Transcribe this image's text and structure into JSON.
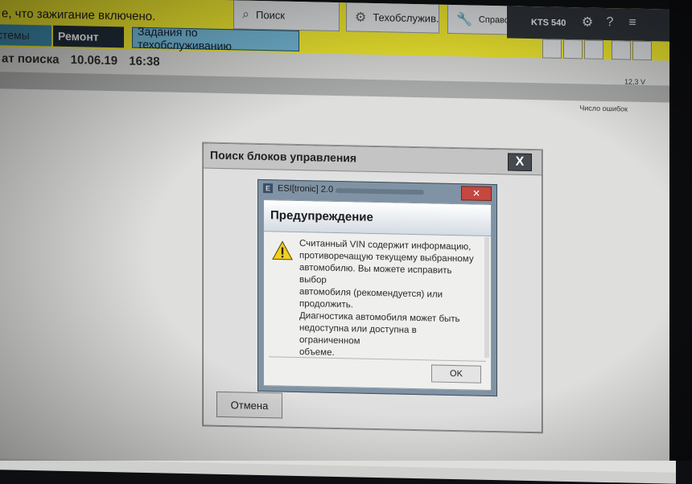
{
  "header": {
    "message": "е, что зажигание включено.",
    "search_button": "Поиск",
    "service_button": "Техобслужив.",
    "reference_button": "Справочники",
    "device": "KTS 540",
    "voltage": "12,3 V"
  },
  "tabs": {
    "systems": "стемы",
    "repair": "Ремонт",
    "service_tasks": "Задания по техобслуживанию"
  },
  "search_info": {
    "label": "ат поиска",
    "date": "10.06.19",
    "time": "16:38"
  },
  "table": {
    "column_header": "Число ошибок"
  },
  "outer_dialog": {
    "title": "Поиск блоков управления",
    "close_label": "X",
    "cancel_label": "Отмена"
  },
  "esi_dialog": {
    "app_title": "ESI[tronic] 2.0",
    "heading": "Предупреждение",
    "message_lines": [
      "Считанный VIN содержит информацию,",
      "противоречащую текущему выбранному",
      "автомобилю. Вы можете исправить выбор",
      "автомобиля (рекомендуется) или",
      "продолжить.",
      "Диагностика автомобиля может быть",
      "недоступна или доступна в ограниченном",
      "объеме."
    ],
    "ok_label": "OK",
    "close_label": "✕"
  },
  "colors": {
    "header_yellow": "#e6df2e",
    "tab_dark": "#1f2a37",
    "tab_blue": "#6fb1ce",
    "esi_frame": "#7f93a4",
    "close_red": "#c4483f"
  },
  "icons": [
    "search-icon",
    "gear-icon",
    "wrench-icon",
    "warning-icon",
    "close-icon",
    "help-icon",
    "menu-icon"
  ]
}
